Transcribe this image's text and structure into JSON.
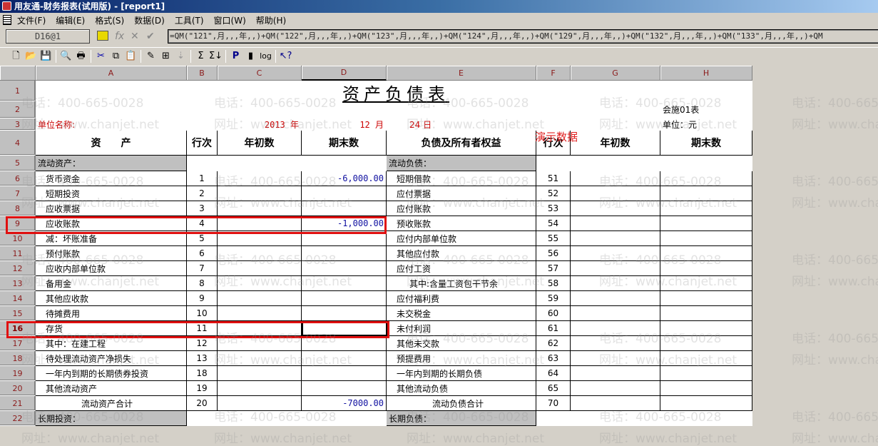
{
  "window": {
    "title": "用友通-财务报表(试用版) - [report1]"
  },
  "menu": [
    "文件(F)",
    "编辑(E)",
    "格式(S)",
    "数据(D)",
    "工具(T)",
    "窗口(W)",
    "帮助(H)"
  ],
  "formula_bar": {
    "cell_ref": "D16@1",
    "formula": "=QM(\"121\",月,,,年,,)+QM(\"122\",月,,,年,,)+QM(\"123\",月,,,年,,)+QM(\"124\",月,,,年,,)+QM(\"129\",月,,,年,,)+QM(\"132\",月,,,年,,)+QM(\"133\",月,,,年,,)+QM"
  },
  "toolbar": [
    "new",
    "open",
    "save",
    "preview",
    "print",
    "cut",
    "copy",
    "paste",
    "format-painter",
    "insert",
    "sort",
    "sum",
    "sum-down",
    "p",
    "script",
    "log",
    "help"
  ],
  "columns": [
    "A",
    "B",
    "C",
    "D",
    "E",
    "F",
    "G",
    "H"
  ],
  "report": {
    "title": "资产负债表",
    "form_no": "会施01表",
    "unit_name_label": "单位名称:",
    "year": "2013 年",
    "month": "12 月",
    "day": "24 日",
    "currency": "单位：元",
    "demo_label": "演示数据",
    "headers": [
      "资　　产",
      "行次",
      "年初数",
      "期末数",
      "负债及所有者权益",
      "行次",
      "年初数",
      "期末数"
    ],
    "section_assets": "流动资产：",
    "section_liabilities": "流动负债：",
    "section_long_assets": "长期投资：",
    "section_long_liabilities": "长期负债："
  },
  "rows": [
    {
      "n": "6",
      "a": "货币资金",
      "b": "1",
      "c": "",
      "d": "-6,000.00",
      "e": "短期借款",
      "f": "51",
      "g": "",
      "h": ""
    },
    {
      "n": "7",
      "a": "短期投资",
      "b": "2",
      "c": "",
      "d": "",
      "e": "应付票据",
      "f": "52",
      "g": "",
      "h": ""
    },
    {
      "n": "8",
      "a": "应收票据",
      "b": "3",
      "c": "",
      "d": "",
      "e": "应付账款",
      "f": "53",
      "g": "",
      "h": ""
    },
    {
      "n": "9",
      "a": "应收账款",
      "b": "4",
      "c": "",
      "d": "-1,000.00",
      "e": "预收账款",
      "f": "54",
      "g": "",
      "h": ""
    },
    {
      "n": "10",
      "a": "减：坏账准备",
      "b": "5",
      "c": "",
      "d": "",
      "e": "应付内部单位款",
      "f": "55",
      "g": "",
      "h": ""
    },
    {
      "n": "11",
      "a": "预付账款",
      "b": "6",
      "c": "",
      "d": "",
      "e": "其他应付款",
      "f": "56",
      "g": "",
      "h": ""
    },
    {
      "n": "12",
      "a": "应收内部单位款",
      "b": "7",
      "c": "",
      "d": "",
      "e": "应付工资",
      "f": "57",
      "g": "",
      "h": ""
    },
    {
      "n": "13",
      "a": "备用金",
      "b": "8",
      "c": "",
      "d": "",
      "e": "其中:含量工资包干节余",
      "f": "58",
      "g": "",
      "h": "",
      "sub": true
    },
    {
      "n": "14",
      "a": "其他应收款",
      "b": "9",
      "c": "",
      "d": "",
      "e": "应付福利费",
      "f": "59",
      "g": "",
      "h": ""
    },
    {
      "n": "15",
      "a": "待摊费用",
      "b": "10",
      "c": "",
      "d": "",
      "e": "未交税金",
      "f": "60",
      "g": "",
      "h": ""
    },
    {
      "n": "16",
      "a": "存货",
      "b": "11",
      "c": "",
      "d": "",
      "e": "未付利润",
      "f": "61",
      "g": "",
      "h": ""
    },
    {
      "n": "17",
      "a": "其中：在建工程",
      "b": "12",
      "c": "",
      "d": "",
      "e": "其他未交款",
      "f": "62",
      "g": "",
      "h": ""
    },
    {
      "n": "18",
      "a": "待处理流动资产净损失",
      "b": "13",
      "c": "",
      "d": "",
      "e": "预提费用",
      "f": "63",
      "g": "",
      "h": ""
    },
    {
      "n": "19",
      "a": "一年内到期的长期债券投资",
      "b": "18",
      "c": "",
      "d": "",
      "e": "一年内到期的长期负债",
      "f": "64",
      "g": "",
      "h": ""
    },
    {
      "n": "20",
      "a": "其他流动资产",
      "b": "19",
      "c": "",
      "d": "",
      "e": "其他流动负债",
      "f": "65",
      "g": "",
      "h": ""
    },
    {
      "n": "21",
      "a": "流动资产合计",
      "b": "20",
      "c": "",
      "d": "-7000.00",
      "e": "流动负债合计",
      "f": "70",
      "g": "",
      "h": "",
      "total": true
    }
  ],
  "watermark": {
    "phone": "电话：400-665-0028",
    "url": "网址：www.chanjet.net"
  },
  "colors": {
    "highlight": "#e01010",
    "number": "#1010a0",
    "label_red": "#cc0000"
  }
}
